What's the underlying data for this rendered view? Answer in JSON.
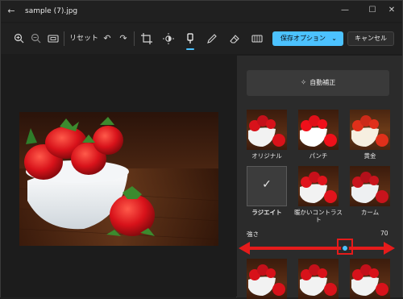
{
  "window": {
    "title": "sample (7).jpg",
    "back_icon": "back-arrow-icon",
    "min_icon": "minimize-icon",
    "max_icon": "maximize-icon",
    "close_icon": "close-icon"
  },
  "toolbar": {
    "zoom_in_icon": "zoom-in-icon",
    "zoom_out_icon": "zoom-out-icon",
    "fit_icon": "fit-to-window-icon",
    "reset_label": "リセット",
    "undo_icon": "undo-icon",
    "redo_icon": "redo-icon",
    "crop_icon": "crop-icon",
    "adjust_icon": "brightness-icon",
    "filter_icon": "filter-icon",
    "markup_icon": "markup-pen-icon",
    "erase_icon": "eraser-icon",
    "background_icon": "background-icon",
    "save_label": "保存オプション",
    "save_chevron": "⌄",
    "cancel_label": "キャンセル",
    "accent_color": "#4cc2ff"
  },
  "panel": {
    "auto_enhance_label": "自動補正",
    "auto_enhance_icon": "magic-wand-icon",
    "filters": [
      {
        "label": "オリジナル",
        "selected": false
      },
      {
        "label": "パンチ",
        "selected": false
      },
      {
        "label": "黄金",
        "selected": false
      },
      {
        "label": "ラジエイト",
        "selected": true
      },
      {
        "label": "暖かいコントラスト",
        "selected": false
      },
      {
        "label": "カーム",
        "selected": false
      }
    ],
    "selected_check": "✓",
    "strength_label": "強さ",
    "strength_value": "70",
    "strength_fraction": 0.7
  },
  "annotation": {
    "highlight_color": "#e51b1b"
  }
}
